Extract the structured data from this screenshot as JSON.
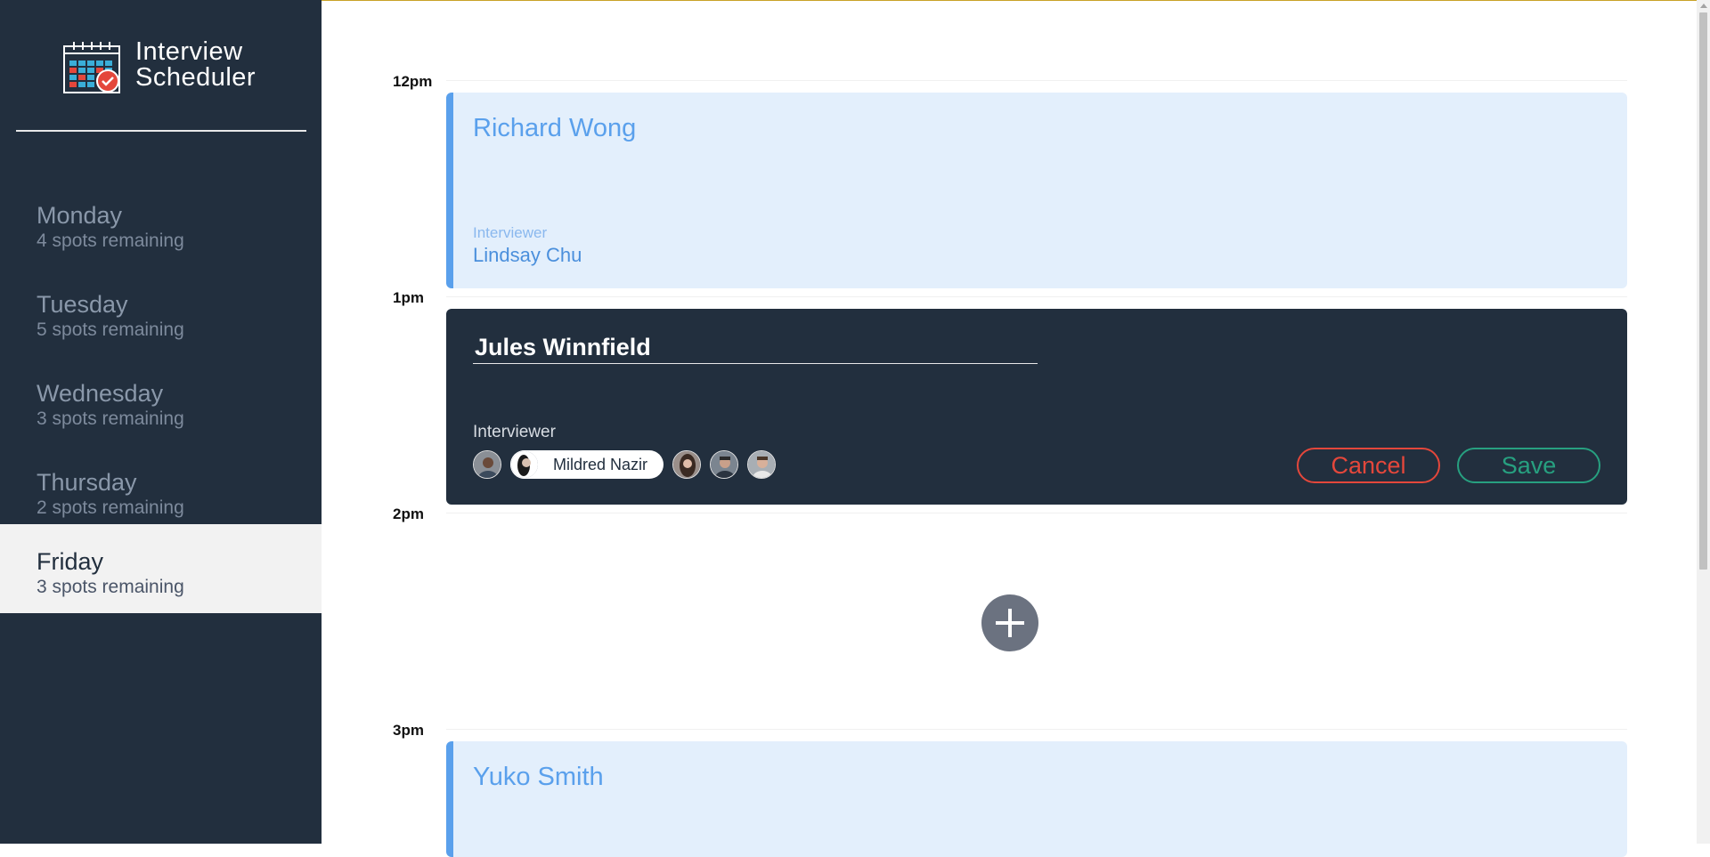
{
  "app": {
    "title_line1": "Interview",
    "title_line2": "Scheduler",
    "logo_icon": "calendar-check-icon"
  },
  "sidebar": {
    "days": [
      {
        "name": "Monday",
        "spots": "4 spots remaining",
        "selected": false
      },
      {
        "name": "Tuesday",
        "spots": "5 spots remaining",
        "selected": false
      },
      {
        "name": "Wednesday",
        "spots": "3 spots remaining",
        "selected": false
      },
      {
        "name": "Thursday",
        "spots": "2 spots remaining",
        "selected": false
      },
      {
        "name": "Friday",
        "spots": "3 spots remaining",
        "selected": true
      }
    ]
  },
  "schedule": {
    "times": [
      "12pm",
      "1pm",
      "2pm",
      "3pm"
    ],
    "appointments": [
      {
        "time": "12pm",
        "student": "Richard Wong",
        "interviewer_label": "Interviewer",
        "interviewer": "Lindsay Chu"
      },
      {
        "time": "3pm",
        "student": "Yuko Smith"
      }
    ],
    "form": {
      "time": "1pm",
      "student_value": "Jules Winnfield",
      "interviewer_label": "Interviewer",
      "selected_interviewer": "Mildred Nazir",
      "cancel_label": "Cancel",
      "save_label": "Save"
    },
    "empty_slot": {
      "time": "2pm",
      "add_icon": "plus-icon"
    }
  },
  "colors": {
    "sidebar_bg": "#222f3e",
    "appointment_bg": "#e3effc",
    "appointment_accent": "#5aa0ec",
    "cancel": "#e4473b",
    "save": "#27a080"
  }
}
